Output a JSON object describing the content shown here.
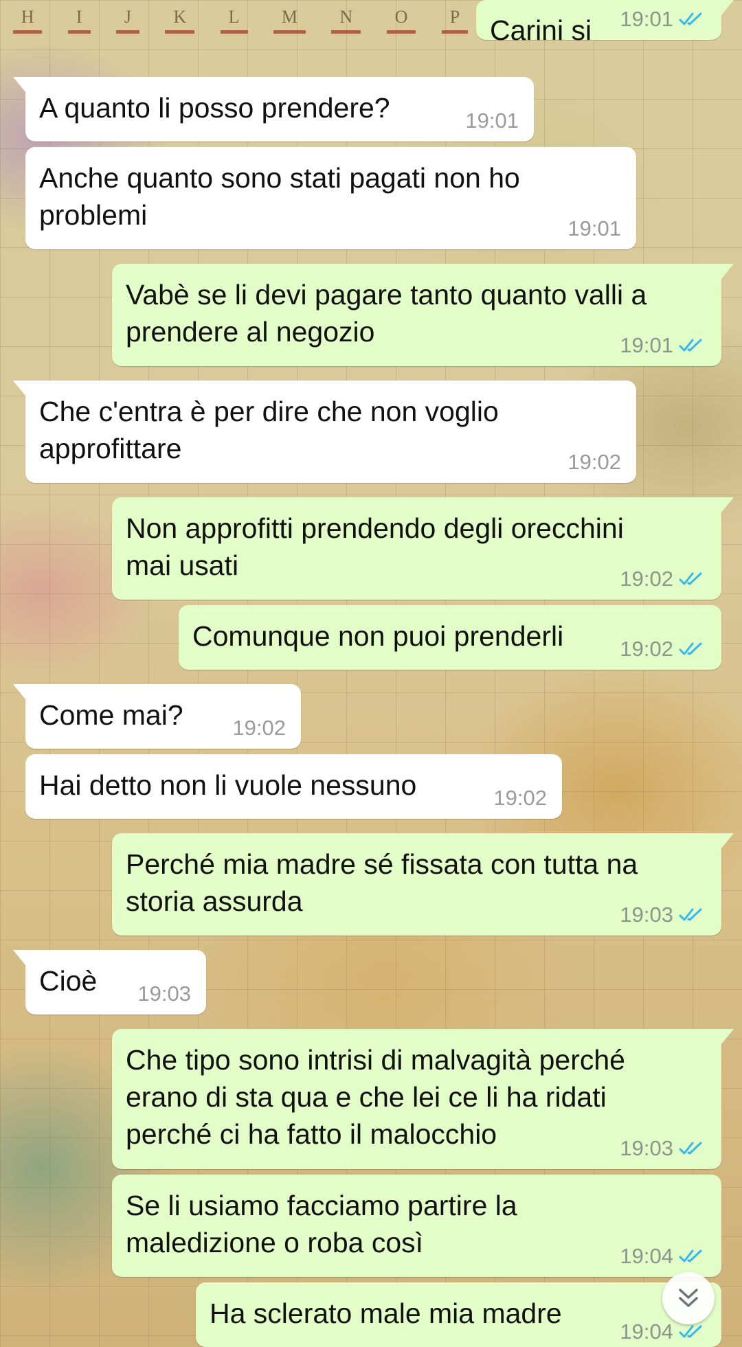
{
  "wallpaper": {
    "map_column_letters": [
      "H",
      "I",
      "J",
      "K",
      "L",
      "M",
      "N",
      "O",
      "P"
    ]
  },
  "chat": {
    "messages": [
      {
        "direction": "outgoing",
        "lines": [
          "Carini si"
        ],
        "time": "19:01",
        "status": "read"
      },
      {
        "direction": "incoming",
        "lines": [
          "A quanto li posso prendere?"
        ],
        "time": "19:01"
      },
      {
        "direction": "incoming",
        "lines": [
          "Anche quanto sono stati pagati non ho",
          "problemi"
        ],
        "time": "19:01"
      },
      {
        "direction": "outgoing",
        "lines": [
          "Vabè se li devi pagare tanto quanto valli a",
          "prendere al negozio"
        ],
        "time": "19:01",
        "status": "read"
      },
      {
        "direction": "incoming",
        "lines": [
          "Che c'entra è per dire che non voglio",
          "approfittare"
        ],
        "time": "19:02"
      },
      {
        "direction": "outgoing",
        "lines": [
          "Non approfitti prendendo degli orecchini",
          "mai usati"
        ],
        "time": "19:02",
        "status": "read"
      },
      {
        "direction": "outgoing",
        "lines": [
          "Comunque non puoi prenderli"
        ],
        "time": "19:02",
        "status": "read"
      },
      {
        "direction": "incoming",
        "lines": [
          "Come mai?"
        ],
        "time": "19:02"
      },
      {
        "direction": "incoming",
        "lines": [
          "Hai detto non li vuole nessuno"
        ],
        "time": "19:02"
      },
      {
        "direction": "outgoing",
        "lines": [
          "Perché mia madre sé fissata con tutta na",
          "storia assurda"
        ],
        "time": "19:03",
        "status": "read"
      },
      {
        "direction": "incoming",
        "lines": [
          "Cioè"
        ],
        "time": "19:03"
      },
      {
        "direction": "outgoing",
        "lines": [
          "Che tipo sono intrisi di malvagità perché",
          "erano di sta qua e che lei ce li ha ridati",
          "perché ci ha fatto il malocchio"
        ],
        "time": "19:03",
        "status": "read"
      },
      {
        "direction": "outgoing",
        "lines": [
          "Se li usiamo facciamo partire la",
          "maledizione o roba così"
        ],
        "time": "19:04",
        "status": "read"
      },
      {
        "direction": "outgoing",
        "lines": [
          "Ha sclerato male mia madre"
        ],
        "time": "19:04",
        "status": "read"
      }
    ],
    "scroll_button_icon": "double-chevron-down-icon",
    "colors": {
      "incoming_bubble": "#ffffff",
      "outgoing_bubble": "#e2fdc7",
      "read_ticks": "#34b7f1",
      "timestamp": "#8a968b"
    }
  }
}
